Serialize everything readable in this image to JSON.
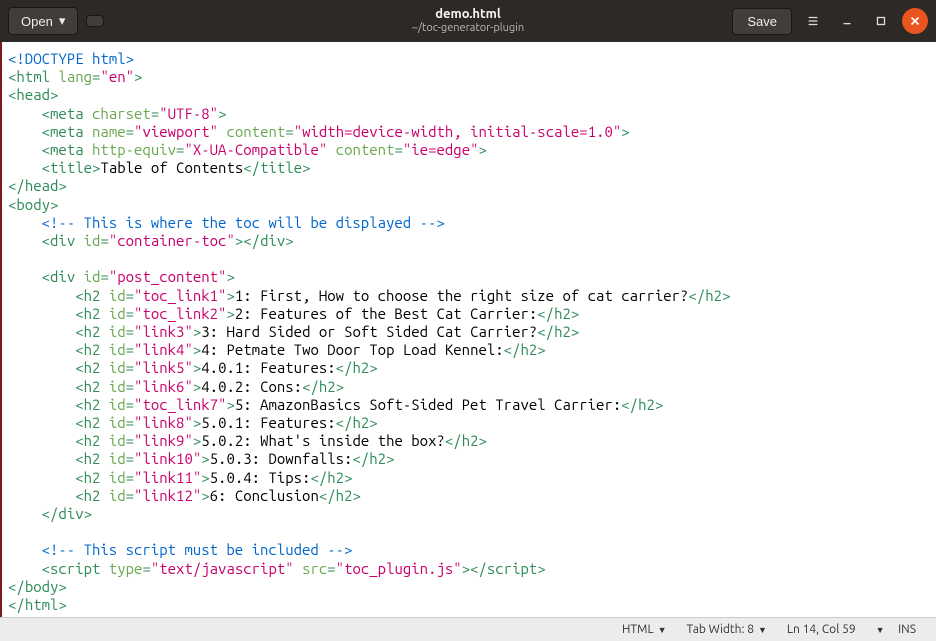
{
  "header": {
    "open_label": "Open",
    "save_label": "Save",
    "filename": "demo.html",
    "filepath": "~/toc-generator-plugin"
  },
  "code": {
    "doctype": "<!DOCTYPE html>",
    "html_open": {
      "tag": "html",
      "attr": "lang",
      "val": "\"en\""
    },
    "head_open": "head",
    "meta1": {
      "attr": "charset",
      "val": "\"UTF-8\""
    },
    "meta2": {
      "a1": "name",
      "v1": "\"viewport\"",
      "a2": "content",
      "v2": "\"width=device-width, initial-scale=1.0\""
    },
    "meta3": {
      "a1": "http-equiv",
      "v1": "\"X-UA-Compatible\"",
      "a2": "content",
      "v2": "\"ie=edge\""
    },
    "title_tag": "title",
    "title_text": "Table of Contents",
    "head_close": "head",
    "body_open": "body",
    "comment1": "<!-- This is where the toc will be displayed -->",
    "div1": {
      "id": "\"container-toc\""
    },
    "div2": {
      "id": "\"post_content\""
    },
    "h2_1": {
      "id": "\"toc_link1\"",
      "text": "1: First, How to choose the right size of cat carrier?"
    },
    "h2_2": {
      "id": "\"toc_link2\"",
      "text": "2: Features of the Best Cat Carrier:"
    },
    "h2_3": {
      "id": "\"link3\"",
      "text": "3: Hard Sided or Soft Sided Cat Carrier?"
    },
    "h2_4": {
      "id": "\"link4\"",
      "text": "4: Petmate Two Door Top Load Kennel:"
    },
    "h2_5": {
      "id": "\"link5\"",
      "text": "4.0.1: Features:"
    },
    "h2_6": {
      "id": "\"link6\"",
      "text": "4.0.2: Cons:"
    },
    "h2_7": {
      "id": "\"toc_link7\"",
      "text": "5: AmazonBasics Soft-Sided Pet Travel Carrier:"
    },
    "h2_8": {
      "id": "\"link8\"",
      "text": "5.0.1: Features:"
    },
    "h2_9": {
      "id": "\"link9\"",
      "text": "5.0.2: What's inside the box?"
    },
    "h2_10": {
      "id": "\"link10\"",
      "text": "5.0.3: Downfalls:"
    },
    "h2_11": {
      "id": "\"link11\"",
      "text": "5.0.4: Tips:"
    },
    "h2_12": {
      "id": "\"link12\"",
      "text": "6: Conclusion"
    },
    "div_close": "div",
    "comment2": "<!-- This script must be included -->",
    "script": {
      "a1": "type",
      "v1": "\"text/javascript\"",
      "a2": "src",
      "v2": "\"toc_plugin.js\""
    },
    "body_close": "body",
    "html_close": "html"
  },
  "status": {
    "lang": "HTML",
    "tabwidth": "Tab Width: 8",
    "cursor": "Ln 14, Col 59",
    "insert": "INS"
  }
}
